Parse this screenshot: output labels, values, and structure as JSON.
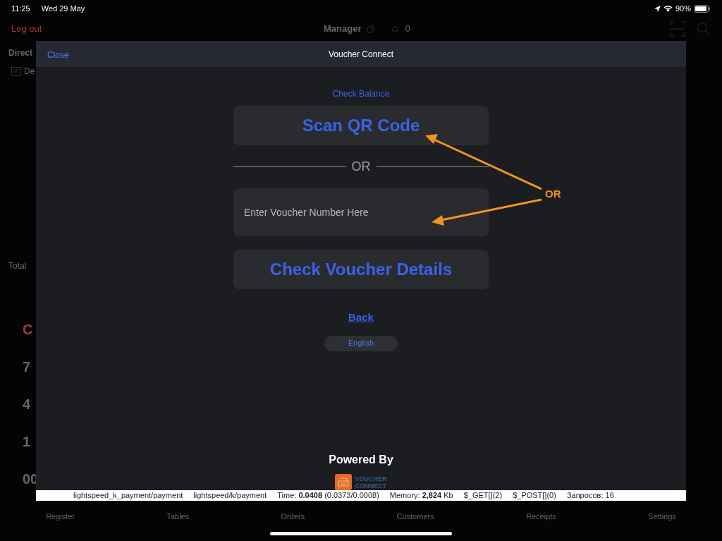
{
  "status_bar": {
    "time": "11:25",
    "date": "Wed 29 May",
    "battery": "90%"
  },
  "background_app": {
    "header": {
      "logout": "Log out",
      "user": "Manager",
      "notifications": "0"
    },
    "panel": {
      "title": "Direct",
      "item": "De",
      "total": "Total"
    },
    "keypad": [
      {
        "label": "C",
        "kind": "clear"
      },
      {
        "label": "7",
        "kind": "digit"
      },
      {
        "label": "4",
        "kind": "digit"
      },
      {
        "label": "1",
        "kind": "digit"
      },
      {
        "label": "00",
        "kind": "digit"
      }
    ],
    "tab_bar": [
      "Register",
      "Tables",
      "Orders",
      "Customers",
      "Receipts",
      "Settings"
    ]
  },
  "modal": {
    "close": "Close",
    "title": "Voucher Connect",
    "check_balance": "Check Balance",
    "scan_button": "Scan QR Code",
    "divider": "OR",
    "voucher_field": {
      "placeholder": "Enter Voucher Number Here"
    },
    "check_button": "Check Voucher Details",
    "back": "Back",
    "language": "English",
    "powered_by": "Powered By",
    "logo_text": [
      "VOUCHER",
      "CONNECT"
    ]
  },
  "debug_bar": [
    "lightspeed_k_payment/payment",
    "lightspeed/k/payment",
    "Time: **0.0408** (0.0373/0.0008)",
    "Memory: **2,824** Kb",
    "$_GET[](2)",
    "$_POST[](0)",
    "Запросов: 16"
  ],
  "annotation": {
    "label": "OR"
  }
}
